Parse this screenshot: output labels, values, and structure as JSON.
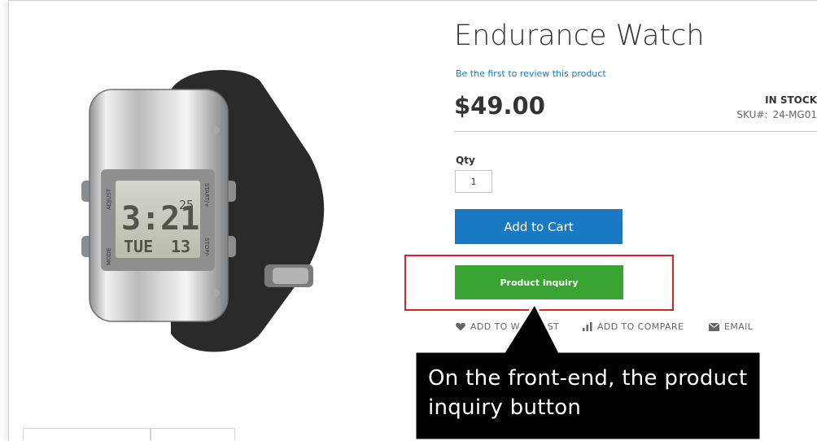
{
  "product": {
    "title": "Endurance Watch",
    "review_link": "Be the first to review this product",
    "price": "$49.00",
    "stock": "IN STOCK",
    "sku_label": "SKU#:",
    "sku_value": "24-MG01"
  },
  "watch_display": {
    "time": "3:21",
    "seconds": "25",
    "day": "TUE",
    "date": "13",
    "button_labels": [
      "ADJUST",
      "MODE",
      "START/+",
      "STOP/-"
    ]
  },
  "form": {
    "qty_label": "Qty",
    "qty_value": "1",
    "add_to_cart_label": "Add to Cart",
    "inquiry_label": "Product inquiry"
  },
  "actions": {
    "wishlist_label": "ADD TO WISH LIST",
    "compare_label": "ADD TO COMPARE",
    "email_label": "EMAIL"
  },
  "callout": {
    "text": "On the front-end,  the product inquiry  button"
  },
  "colors": {
    "primary_blue": "#1979c3",
    "inquiry_green": "#39a432",
    "highlight_red": "#d92323",
    "callout_black": "#000000"
  }
}
